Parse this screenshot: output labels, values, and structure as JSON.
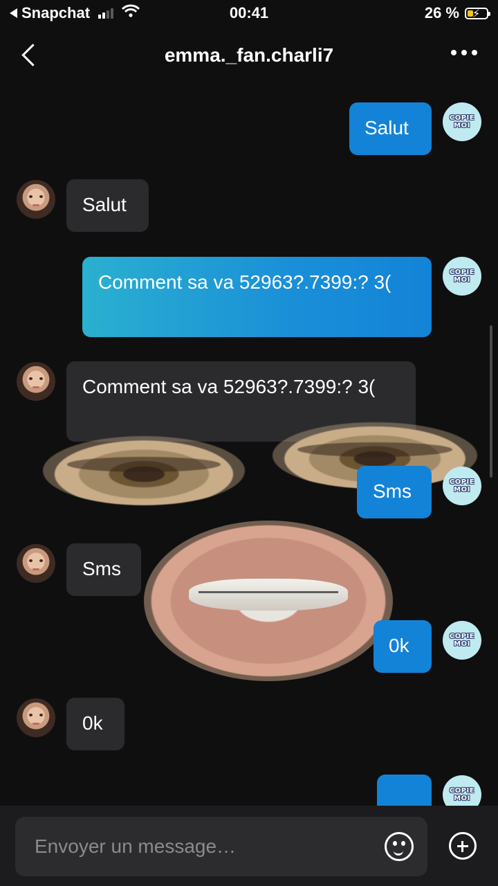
{
  "status_bar": {
    "back_app": "Snapchat",
    "time": "00:41",
    "battery_percent": "26 %",
    "battery_level": 0.26,
    "signal_bars_on": 2,
    "signal_bars_total": 4
  },
  "header": {
    "title": "emma._fan.charli7",
    "back_icon": "chevron-left-icon",
    "more_icon": "more-dots-icon"
  },
  "avatar_out_text": [
    "COPIE",
    "MOI"
  ],
  "messages": [
    {
      "dir": "out",
      "text": "Salut"
    },
    {
      "dir": "in",
      "text": "Salut"
    },
    {
      "dir": "out",
      "text": "Comment sa va 52963?.7399:? 3("
    },
    {
      "dir": "in",
      "text": "Comment sa va 52963?.7399:? 3("
    },
    {
      "dir": "out",
      "text": "Sms"
    },
    {
      "dir": "in",
      "text": "Sms"
    },
    {
      "dir": "out",
      "text": "0k"
    },
    {
      "dir": "in",
      "text": "0k"
    },
    {
      "dir": "out",
      "text": ""
    }
  ],
  "composer": {
    "placeholder": "Envoyer un message…",
    "emoji_icon": "smiley-icon",
    "add_icon": "plus-circle-icon"
  },
  "colors": {
    "outgoing_bubble": "#1383d7",
    "incoming_bubble": "#2b2b2d",
    "background": "#0f0f10"
  }
}
